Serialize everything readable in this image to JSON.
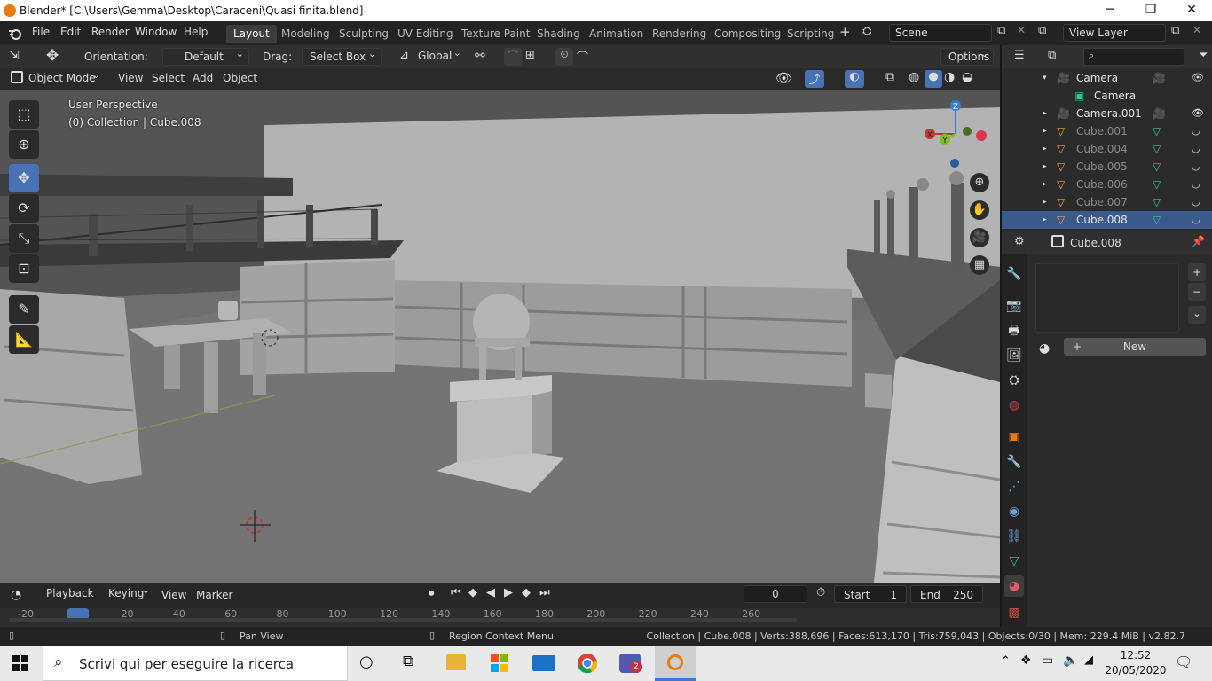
{
  "window": {
    "title": "Blender* [C:\\Users\\Gemma\\Desktop\\Caraceni\\Quasi finita.blend]",
    "minimize": "─",
    "maximize": "❐",
    "close": "✕"
  },
  "menu": {
    "items": [
      "File",
      "Edit",
      "Render",
      "Window",
      "Help"
    ]
  },
  "workspaces": [
    "Layout",
    "Modeling",
    "Sculpting",
    "UV Editing",
    "Texture Paint",
    "Shading",
    "Animation",
    "Rendering",
    "Compositing",
    "Scripting"
  ],
  "add_workspace": "+",
  "scene": {
    "name": "Scene",
    "view_layer": "View Layer"
  },
  "toolheader": {
    "orientation_label": "Orientation:",
    "orientation_value": "Default",
    "drag_label": "Drag:",
    "drag_value": "Select Box",
    "transform_orientation": "Global",
    "options": "Options"
  },
  "viewheader": {
    "mode": "Object Mode",
    "items": [
      "View",
      "Select",
      "Add",
      "Object"
    ]
  },
  "viewport": {
    "perspective": "User Perspective",
    "collection": "(0) Collection | Cube.008",
    "axes": {
      "x": "X",
      "y": "Y",
      "z": "Z"
    }
  },
  "outliner": {
    "rows": [
      {
        "name": "Camera",
        "indent": 1,
        "type": "camera",
        "dim": false,
        "selected": false
      },
      {
        "name": "Camera",
        "indent": 2,
        "type": "camera-data",
        "dim": false,
        "selected": false
      },
      {
        "name": "Camera.001",
        "indent": 1,
        "type": "camera",
        "dim": false,
        "selected": false
      },
      {
        "name": "Cube.001",
        "indent": 1,
        "type": "mesh",
        "dim": true,
        "selected": false
      },
      {
        "name": "Cube.004",
        "indent": 1,
        "type": "mesh",
        "dim": true,
        "selected": false
      },
      {
        "name": "Cube.005",
        "indent": 1,
        "type": "mesh",
        "dim": true,
        "selected": false
      },
      {
        "name": "Cube.006",
        "indent": 1,
        "type": "mesh",
        "dim": true,
        "selected": false
      },
      {
        "name": "Cube.007",
        "indent": 1,
        "type": "mesh",
        "dim": true,
        "selected": false
      },
      {
        "name": "Cube.008",
        "indent": 1,
        "type": "mesh",
        "dim": true,
        "selected": true
      }
    ]
  },
  "properties": {
    "object_name": "Cube.008",
    "new_label": "New",
    "plus": "+",
    "minus": "−"
  },
  "timeline": {
    "menus": [
      "Playback",
      "Keying",
      "View",
      "Marker"
    ],
    "current_frame": "0",
    "start_label": "Start",
    "start": "1",
    "end_label": "End",
    "end": "250",
    "ticks": [
      "-20",
      "0",
      "20",
      "40",
      "60",
      "80",
      "100",
      "120",
      "140",
      "160",
      "180",
      "200",
      "220",
      "240",
      "260"
    ]
  },
  "status": {
    "pan": "Pan View",
    "context": "Region Context Menu",
    "info": "Collection | Cube.008 | Verts:388,696 | Faces:613,170 | Tris:759,043 | Objects:0/30 | Mem: 229.4 MiB | v2.82.7"
  },
  "taskbar": {
    "search_placeholder": "Scrivi qui per eseguire la ricerca",
    "time": "12:52",
    "date": "20/05/2020",
    "teams_badge": "2"
  },
  "colors": {
    "accent": "#4772b3",
    "orange": "#e87d0d",
    "bg": "#303030"
  }
}
